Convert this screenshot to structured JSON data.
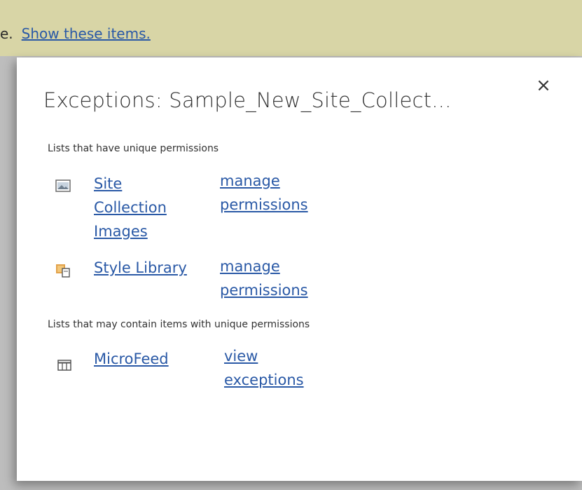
{
  "notification": {
    "leading_text": "e.",
    "link_label": "Show these items."
  },
  "dialog": {
    "title": "Exceptions: Sample_New_Site_Collect...",
    "close_label": "×",
    "sections": [
      {
        "heading": "Lists that have unique permissions",
        "items": [
          {
            "icon": "image-library-icon",
            "name_lines": [
              "Site",
              "Collection",
              "Images"
            ],
            "action_lines": [
              "manage",
              "permissions"
            ]
          },
          {
            "icon": "style-library-icon",
            "name_lines": [
              "Style Library"
            ],
            "action_lines": [
              "manage",
              "permissions"
            ]
          }
        ]
      },
      {
        "heading": "Lists that may contain items with unique permissions",
        "items": [
          {
            "icon": "list-icon",
            "name_lines": [
              "MicroFeed"
            ],
            "action_lines": [
              "view",
              "exceptions"
            ]
          }
        ]
      }
    ]
  }
}
